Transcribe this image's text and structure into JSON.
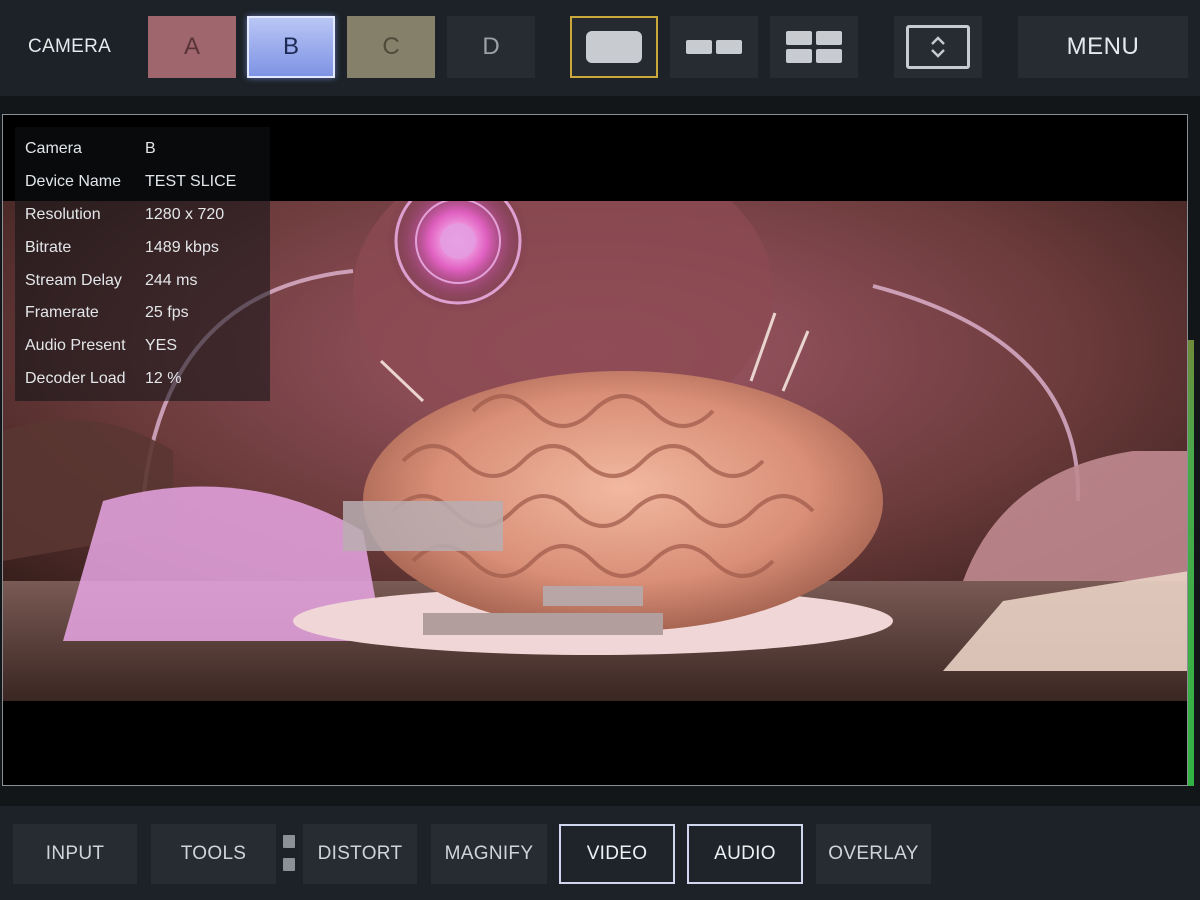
{
  "header": {
    "camera_label": "CAMERA",
    "cameras": [
      {
        "label": "A",
        "color": "#a0666d"
      },
      {
        "label": "B",
        "color": "#8fa1ea",
        "selected": true
      },
      {
        "label": "C",
        "color": "#85806a"
      },
      {
        "label": "D",
        "color": "#262c32"
      }
    ],
    "layouts": [
      "single-view-icon",
      "dual-view-icon",
      "quad-view-icon"
    ],
    "selected_layout": "single-view-icon",
    "fullscreen_icon": "fullscreen-toggle-icon",
    "menu_label": "MENU"
  },
  "stream_info": [
    {
      "key": "Camera",
      "value": "B"
    },
    {
      "key": "Device Name",
      "value": "TEST SLICE"
    },
    {
      "key": "Resolution",
      "value": "1280 x 720"
    },
    {
      "key": "Bitrate",
      "value": "1489 kbps"
    },
    {
      "key": "Stream Delay",
      "value": "244 ms"
    },
    {
      "key": "Framerate",
      "value": "25 fps"
    },
    {
      "key": "Audio Present",
      "value": "YES"
    },
    {
      "key": "Decoder Load",
      "value": "12 %"
    }
  ],
  "toolbar": {
    "buttons": [
      {
        "label": "INPUT",
        "active": false
      },
      {
        "label": "TOOLS",
        "active": false
      },
      {
        "label": "DISTORT",
        "active": false
      },
      {
        "label": "MAGNIFY",
        "active": false
      },
      {
        "label": "VIDEO",
        "active": true
      },
      {
        "label": "AUDIO",
        "active": true
      },
      {
        "label": "OVERLAY",
        "active": false
      }
    ]
  },
  "colors": {
    "accent_selected_layout": "#c9a93b",
    "audio_meter": "#32b244"
  }
}
